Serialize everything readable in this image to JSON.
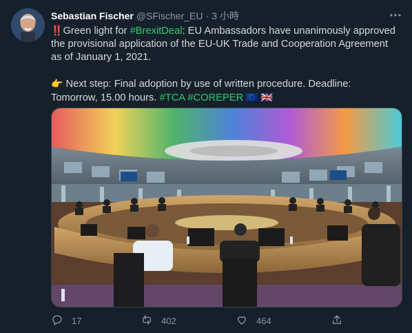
{
  "author": {
    "name": "Sebastian Fischer",
    "handle": "@SFischer_EU",
    "separator": "·",
    "time": "3 小時"
  },
  "tweet": {
    "line1_prefix_emoji": "‼️",
    "line1_prefix": "Green light for ",
    "hashtag1": "#BrexitDeal",
    "line1_rest": ": EU Ambassadors have unanimously approved the provisional application of the EU-UK Trade and Cooperation Agreement as of January 1, 2021.",
    "line2_emoji": "👉",
    "line2_text": " Next step: Final adoption by use of written procedure. Deadline: Tomorrow, 15.00 hours. ",
    "hashtag2": "#TCA",
    "hashtag3": "#COREPER",
    "flag1": "🇪🇺",
    "flag2": "🇬🇧"
  },
  "actions": {
    "reply_count": "17",
    "retweet_count": "402",
    "like_count": "464"
  },
  "icons": {
    "more": "more-icon",
    "reply": "reply-icon",
    "retweet": "retweet-icon",
    "like": "heart-icon",
    "share": "share-icon"
  }
}
